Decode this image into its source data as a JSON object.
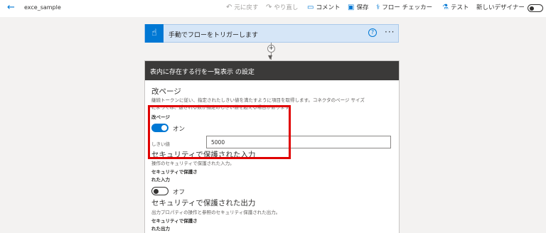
{
  "header": {
    "back_glyph": "←",
    "title": "exce_sample",
    "undo_label": "元に戻す",
    "redo_label": "やり直し",
    "comment_label": "コメント",
    "save_label": "保存",
    "checker_label": "フロー チェッカー",
    "test_label": "テスト",
    "new_designer_label": "新しいデザイナー"
  },
  "trigger": {
    "title": "手動でフローをトリガーします",
    "help_glyph": "?",
    "more_glyph": "···"
  },
  "connector": {
    "plus_glyph": "+",
    "arrow_glyph": "▼"
  },
  "panel": {
    "title": "表内に存在する行を一覧表示 の設定",
    "pagination": {
      "section_title": "改ページ",
      "description_line1": "継続トークンに従い、指定されたしきい値を満たすように項目を取得します。コネクタのページ サイズ",
      "description_line2": "によっては、返される数が指定のしきい値を超える場合があります。",
      "field_label": "改ページ",
      "toggle_state": "オン",
      "threshold_label": "しきい値",
      "threshold_value": "5000"
    },
    "secure_input": {
      "section_title": "セキュリティで保護された入力",
      "description": "操作のセキュリティで保護された入力。",
      "field_label_line1": "セキュリティで保護さ",
      "field_label_line2": "れた入力",
      "toggle_state": "オフ"
    },
    "secure_output": {
      "section_title": "セキュリティで保護された出力",
      "description": "出力プロパティの操作と参照のセキュリティ保護された出力。",
      "field_label_line1": "セキュリティで保護さ",
      "field_label_line2": "れた出力"
    }
  },
  "colors": {
    "accent": "#0078d4",
    "highlight": "#e00000",
    "panel_header": "#3b3a39"
  }
}
